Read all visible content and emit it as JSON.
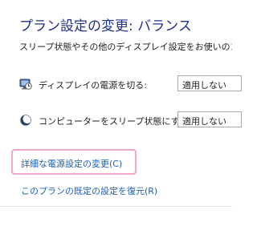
{
  "header": {
    "title": "プラン設定の変更: バランス",
    "subtitle": "スリープ状態やその他のディスプレイ設定をお使いのコンピ"
  },
  "settings": [
    {
      "icon": "monitor-clock-icon",
      "label": "ディスプレイの電源を切る:",
      "value": "適用しない"
    },
    {
      "icon": "moon-sleep-icon",
      "label": "コンピューターをスリープ状態にする:",
      "value": "適用しない"
    }
  ],
  "links": {
    "advanced": "詳細な電源設定の変更(C)",
    "restore": "このプランの既定の設定を復元(R)"
  },
  "colors": {
    "title": "#1e3287",
    "link": "#1f5fa8",
    "highlight": "#f2a6c9"
  }
}
